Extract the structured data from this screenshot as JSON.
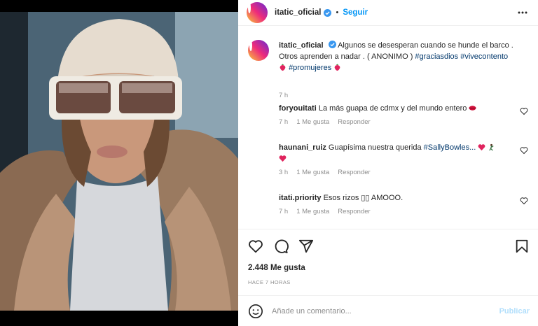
{
  "post": {
    "author": "itatic_oficial",
    "follow_label": "Seguir",
    "dot": "•",
    "caption_text": "Algunos se desesperan cuando se hunde el barco . Otros aprenden a nadar . ( ANONIMO )",
    "caption_tags": [
      "#graciasdios",
      "#vivecontento",
      "#promujeres"
    ],
    "caption_time": "7 h",
    "likes": "2.448 Me gusta",
    "time_ago": "HACE 7 HORAS"
  },
  "comments": [
    {
      "user": "foryouitati",
      "text": "La más guapa de cdmx y del mundo entero",
      "time": "7 h",
      "likes": "1 Me gusta",
      "reply": "Responder"
    },
    {
      "user": "haunani_ruiz",
      "text": "Guapísima nuestra querida",
      "tag": "#SallyBowles...",
      "time": "3 h",
      "likes": "1 Me gusta",
      "reply": "Responder"
    },
    {
      "user": "itati.priority",
      "text": "Esos rizos ▯▯ AMOOO.",
      "time": "7 h",
      "likes": "1 Me gusta",
      "reply": "Responder"
    }
  ],
  "composer": {
    "placeholder": "Añade un comentario...",
    "publish_label": "Publicar"
  },
  "icons": {
    "more": "more-icon",
    "like": "heart-icon",
    "comment": "comment-icon",
    "share": "share-icon",
    "save": "bookmark-icon",
    "emoji": "smile-icon",
    "verified": "verified-badge-icon"
  },
  "colors": {
    "link": "#0095f6",
    "hashtag": "#00376b",
    "muted": "#8e8e8e",
    "publish_disabled": "#b2dffc"
  }
}
